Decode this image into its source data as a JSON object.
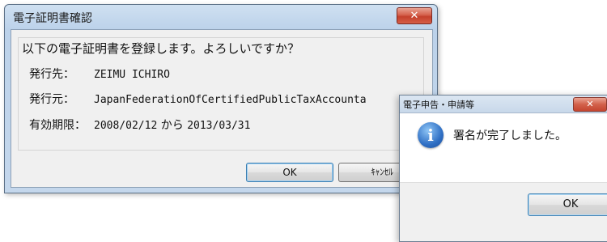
{
  "cert_dialog": {
    "title": "電子証明書確認",
    "close_label": "✕",
    "message": "以下の電子証明書を登録します。よろしいですか？",
    "issued_to_label": "発行先：",
    "issued_to_value": "ZEIMU ICHIRO",
    "issuer_label": "発行元：",
    "issuer_value": "JapanFederationOfCertifiedPublicTaxAccounta",
    "validity_label": "有効期限：",
    "validity_from": "2008/02/12",
    "validity_sep": "から",
    "validity_to": "2013/03/31",
    "ok_label": "OK",
    "cancel_label": "ｷｬﾝｾﾙ"
  },
  "notice_dialog": {
    "title": "電子申告・申請等",
    "close_label": "✕",
    "icon": "info-icon",
    "icon_glyph": "i",
    "message": "署名が完了しました。",
    "ok_label": "OK"
  }
}
